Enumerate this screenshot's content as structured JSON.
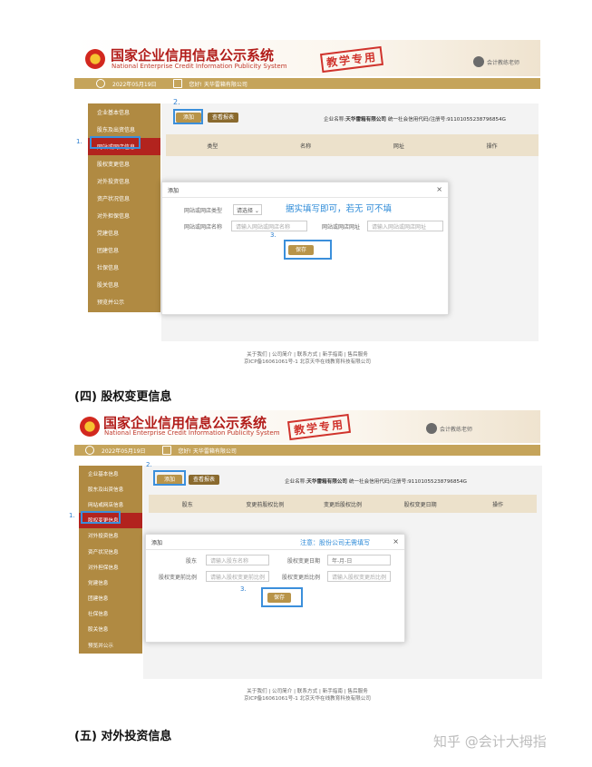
{
  "system": {
    "title": "国家企业信用信息公示系统",
    "subtitle": "National Enterprise Credit Information Publicity System",
    "stamp": "教学专用",
    "user": "会计教练老师",
    "colors": {
      "primary": "#c5a45b",
      "sidebar": "#b08a42",
      "active": "#b2231e",
      "highlight": "#3b8fdb",
      "stamp": "#d0332c"
    }
  },
  "section1": {
    "bar": {
      "date": "2022年05月19日",
      "company": "您好! 天华雷箱有限公司"
    },
    "sidebar": [
      "企业基本信息",
      "股东及出资信息",
      "网站或网店信息",
      "股权变更信息",
      "对外投资信息",
      "资产状况信息",
      "对外担保信息",
      "党建信息",
      "团建信息",
      "社保信息",
      "股关信息",
      "预览并公示"
    ],
    "active_index": 2,
    "buttons": {
      "add": "添加",
      "view": "查看报表"
    },
    "company_info": {
      "label": "企业名称:",
      "name": "天华雷箱有限公司",
      "code_label": "统一社会信用代码/注册号:",
      "code": "91101055238796854G"
    },
    "table_headers": [
      "类型",
      "名称",
      "网址",
      "操作"
    ],
    "modal": {
      "title": "添加",
      "close": "×",
      "note": "据实填写即可，若无 可不填",
      "type_label": "网站或网店类型",
      "type_value": "请选择 ⌄",
      "name_label": "网站或网店名称",
      "name_placeholder": "请输入网站或网店名称",
      "url_label": "网站或网店网址",
      "url_placeholder": "请输入网站或网店网址",
      "save": "保存"
    },
    "steps": {
      "s1": "1.",
      "s2": "2.",
      "s3": "3."
    },
    "footer": {
      "links": "关于我们 | 公司简介 | 联系方式 | 新手指南 | 售后服务",
      "icp": "京ICP备16061061号-1 北京天华在线教育科技有限公司"
    }
  },
  "heading4": "(四) 股权变更信息",
  "section2": {
    "bar": {
      "date": "2022年05月19日",
      "company": "您好! 天华雷箱有限公司"
    },
    "sidebar": [
      "企业基本信息",
      "股东及出资信息",
      "网站或网店信息",
      "股权变更信息",
      "对外投资信息",
      "资产状况信息",
      "对外担保信息",
      "党建信息",
      "团建信息",
      "社保信息",
      "股关信息",
      "预览并公示"
    ],
    "active_index": 3,
    "buttons": {
      "add": "添加",
      "view": "查看报表"
    },
    "company_info": {
      "label": "企业名称:",
      "name": "天华雷箱有限公司",
      "code_label": "统一社会信用代码/注册号:",
      "code": "91101055238796854G"
    },
    "table_headers": [
      "股东",
      "变更前股权比例",
      "变更后股权比例",
      "股权变更日期",
      "操作"
    ],
    "modal": {
      "title": "添加",
      "close": "×",
      "note": "注意：股份公司无需填写",
      "holder_label": "股东",
      "holder_placeholder": "请输入股东名称",
      "date_label": "股权变更日期",
      "date_placeholder": "年-月-日",
      "before_label": "股权变更前比例",
      "before_placeholder": "请输入股权变更前比例",
      "after_label": "股权变更后比例",
      "after_placeholder": "请输入股权变更后比例",
      "save": "保存"
    },
    "steps": {
      "s1": "1.",
      "s2": "2.",
      "s3": "3."
    },
    "footer": {
      "links": "关于我们 | 公司简介 | 联系方式 | 新手指南 | 售后服务",
      "icp": "京ICP备16061061号-1 北京天华在线教育科技有限公司"
    }
  },
  "heading5": "(五) 对外投资信息",
  "watermark": "知乎 @会计大拇指"
}
